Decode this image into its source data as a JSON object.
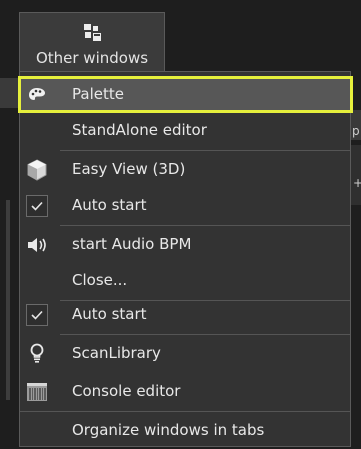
{
  "toolbar": {
    "other_windows_label": "Other windows",
    "other_windows_icon": "windows-grid-icon"
  },
  "menu": {
    "items": [
      {
        "label": "Palette",
        "icon": "palette-icon",
        "highlighted": true
      },
      {
        "label": "StandAlone editor",
        "icon": ""
      },
      {
        "label": "Easy View (3D)",
        "icon": "cube-3d-icon"
      },
      {
        "label": "Auto start",
        "icon": "checkbox-checked-icon",
        "checked": true
      },
      {
        "label": "start Audio BPM",
        "icon": "speaker-icon"
      },
      {
        "label": "Close...",
        "icon": ""
      },
      {
        "label": "Auto start",
        "icon": "checkbox-checked-icon",
        "checked": true
      },
      {
        "label": "ScanLibrary",
        "icon": "lightbulb-icon"
      },
      {
        "label": "Console editor",
        "icon": "console-icon"
      },
      {
        "label": "Organize windows in tabs",
        "icon": ""
      }
    ]
  },
  "background": {
    "right_fragment_1": "p",
    "right_fragment_2": "+"
  },
  "colors": {
    "highlight_border": "#e6f03c",
    "menu_bg": "#333333",
    "text": "#e8e8e8"
  }
}
